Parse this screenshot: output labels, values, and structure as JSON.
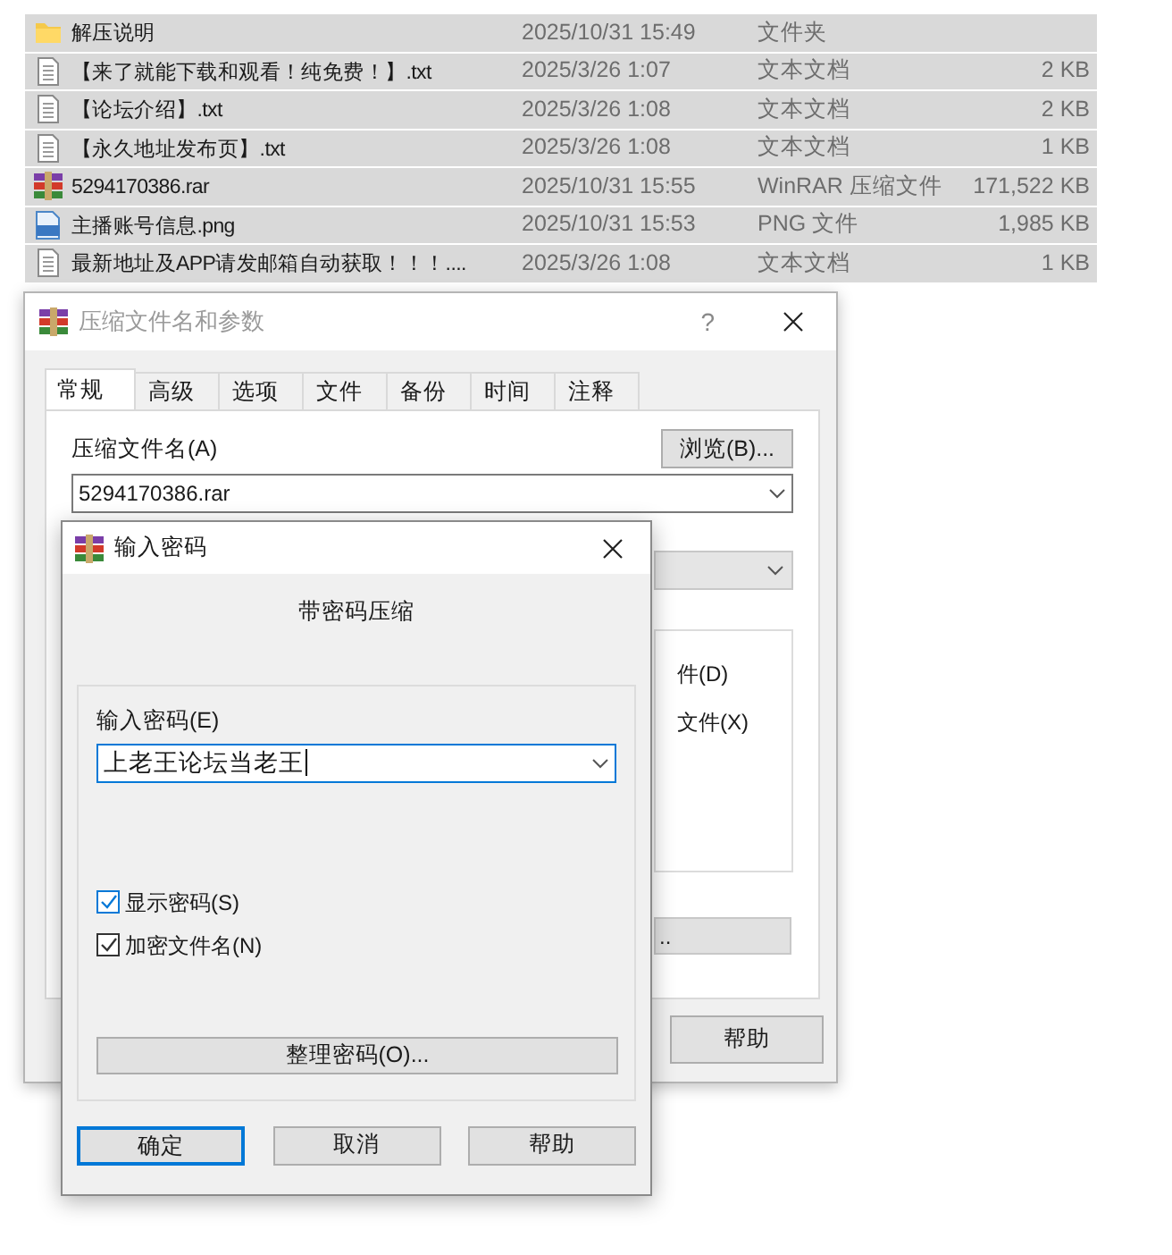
{
  "files": [
    {
      "kind": "folder",
      "name": "解压说明",
      "date": "2025/10/31 15:49",
      "type": "文件夹",
      "selected": true
    },
    {
      "kind": "text",
      "name": "【来了就能下载和观看！纯免费！】.txt",
      "date": "2025/3/26 1:07",
      "type": "文本文档",
      "size": "2 KB",
      "selected": true
    },
    {
      "kind": "text",
      "name": "【论坛介绍】.txt",
      "date": "2025/3/26 1:08",
      "type": "文本文档",
      "size": "2 KB",
      "selected": true
    },
    {
      "kind": "text",
      "name": "【永久地址发布页】.txt",
      "date": "2025/3/26 1:08",
      "type": "文本文档",
      "size": "1 KB",
      "selected": true
    },
    {
      "kind": "rar",
      "name": "5294170386.rar",
      "date": "2025/10/31 15:55",
      "type": "WinRAR 压缩文件",
      "size": "171,522 KB",
      "selected": true
    },
    {
      "kind": "png",
      "name": "主播账号信息.png",
      "date": "2025/10/31 15:53",
      "type": "PNG 文件",
      "size": "1,985 KB",
      "selected": true
    },
    {
      "kind": "text",
      "name": "最新地址及APP请发邮箱自动获取！！！....",
      "date": "2025/3/26 1:08",
      "type": "文本文档",
      "size": "1 KB",
      "selected": true
    }
  ],
  "archive_dialog": {
    "title": "压缩文件名和参数",
    "help_glyph": "?",
    "tabs": [
      {
        "label": "常规",
        "selected": true
      },
      {
        "label": "高级",
        "selected": false
      },
      {
        "label": "选项",
        "selected": false
      },
      {
        "label": "文件",
        "selected": false
      },
      {
        "label": "备份",
        "selected": false
      },
      {
        "label": "时间",
        "selected": false
      },
      {
        "label": "注释",
        "selected": false
      }
    ],
    "archive_name_label": "压缩文件名(A)",
    "browse_button": "浏览(B)...",
    "archive_name_value": "5294170386.rar",
    "partial_options": [
      "件(D)",
      "文件(X)"
    ],
    "partial_button": "..",
    "help_button": "帮助"
  },
  "password_dialog": {
    "title": "输入密码",
    "heading": "带密码压缩",
    "password_label": "输入密码(E)",
    "password_value": "上老王论坛当老王",
    "checkboxes": [
      {
        "label": "显示密码(S)",
        "checked": true
      },
      {
        "label": "加密文件名(N)",
        "checked": true
      }
    ],
    "organize_button": "整理密码(O)...",
    "buttons": [
      {
        "label": "确定",
        "default": true
      },
      {
        "label": "取消",
        "default": false
      },
      {
        "label": "帮助",
        "default": false
      }
    ]
  }
}
